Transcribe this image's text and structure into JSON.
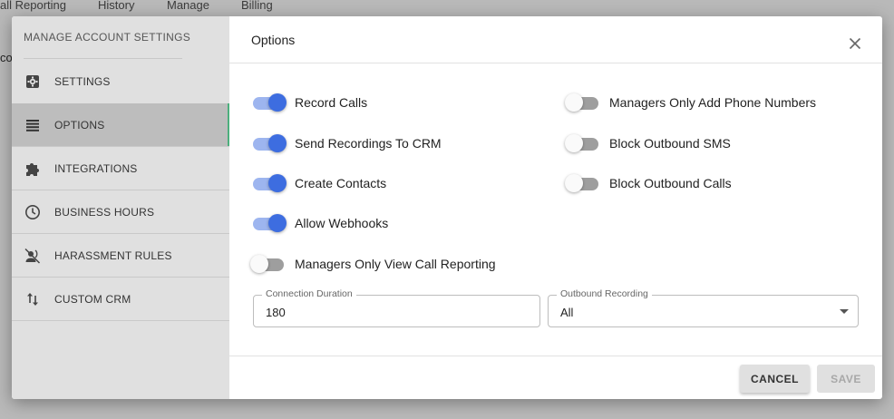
{
  "background": {
    "nav": [
      "all Reporting",
      "History",
      "Manage",
      "Billing"
    ],
    "fragment": "co"
  },
  "sidebar": {
    "title": "MANAGE ACCOUNT SETTINGS",
    "items": [
      {
        "label": "SETTINGS",
        "icon": "gear-icon"
      },
      {
        "label": "OPTIONS",
        "icon": "list-icon",
        "active": true
      },
      {
        "label": "INTEGRATIONS",
        "icon": "puzzle-icon"
      },
      {
        "label": "BUSINESS HOURS",
        "icon": "clock-icon"
      },
      {
        "label": "HARASSMENT RULES",
        "icon": "voice-off-icon"
      },
      {
        "label": "CUSTOM CRM",
        "icon": "swap-vertical-icon"
      }
    ]
  },
  "header": {
    "title": "Options"
  },
  "options": {
    "record_calls": {
      "label": "Record Calls",
      "on": true
    },
    "send_recordings": {
      "label": "Send Recordings To CRM",
      "on": true
    },
    "create_contacts": {
      "label": "Create Contacts",
      "on": true
    },
    "allow_webhooks": {
      "label": "Allow Webhooks",
      "on": true
    },
    "managers_view_reporting": {
      "label": "Managers Only View Call Reporting",
      "on": false
    },
    "managers_add_numbers": {
      "label": "Managers Only Add Phone Numbers",
      "on": false
    },
    "block_sms": {
      "label": "Block Outbound SMS",
      "on": false
    },
    "block_calls": {
      "label": "Block Outbound Calls",
      "on": false
    }
  },
  "fields": {
    "connection_duration": {
      "label": "Connection Duration",
      "value": "180"
    },
    "outbound_recording": {
      "label": "Outbound Recording",
      "value": "All"
    }
  },
  "footer": {
    "cancel": "CANCEL",
    "save": "SAVE"
  },
  "colors": {
    "toggle_on": "#3d6de0",
    "active_accent": "#4caf7d"
  }
}
